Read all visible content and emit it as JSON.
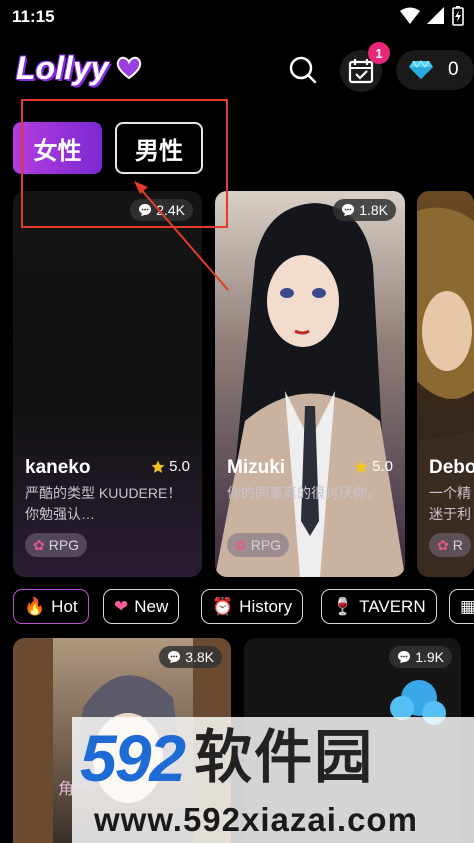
{
  "status_bar": {
    "time": "11:15"
  },
  "header": {
    "logo": "Lollyy",
    "gem_count": "0",
    "checkin_badge": "1"
  },
  "gender_tabs": [
    {
      "label": "女性",
      "active": true
    },
    {
      "label": "男性",
      "active": false
    }
  ],
  "cards": [
    {
      "name": "kaneko",
      "rating": "5.0",
      "chats": "2.4K",
      "desc": "严酷的类型 KUUDERE！你勉强认…",
      "genre": "RPG"
    },
    {
      "name": "Mizuki",
      "rating": "5.0",
      "chats": "1.8K",
      "desc": "你的同事真的很讨厌你。",
      "genre": "RPG"
    },
    {
      "name": "Debo",
      "rating": "",
      "chats": "",
      "desc": "一个精迷于利",
      "genre": "R"
    }
  ],
  "categories": [
    {
      "label": "Hot",
      "icon": "fire-icon",
      "active": true
    },
    {
      "label": "New",
      "icon": "heart-icon",
      "active": false
    },
    {
      "label": "History",
      "icon": "clock-icon",
      "active": false
    },
    {
      "label": "TAVERN",
      "icon": "wine-icon",
      "active": false
    }
  ],
  "bottom_cards": [
    {
      "chats": "3.8K"
    },
    {
      "chats": "1.9K"
    }
  ],
  "bottom_nav_partial": "角",
  "watermark": {
    "digits": "592",
    "title": "软件园",
    "url": "www.592xiazai.com"
  },
  "colors": {
    "accent": "#b43ce0",
    "badge": "#e8267a",
    "annotation": "#e23b2a",
    "star": "#f5c518"
  }
}
